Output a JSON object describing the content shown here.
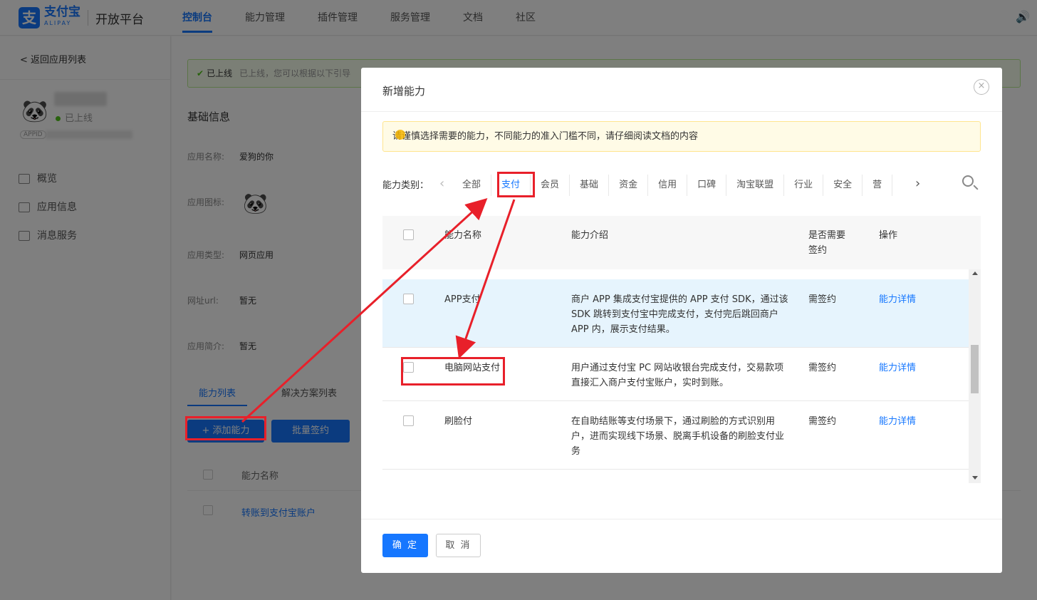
{
  "topbar": {
    "logo_mark": "支",
    "logo_cn": "支付宝",
    "logo_en": "ALIPAY",
    "platform": "开放平台",
    "nav": [
      {
        "label": "控制台",
        "active": true
      },
      {
        "label": "能力管理"
      },
      {
        "label": "插件管理"
      },
      {
        "label": "服务管理"
      },
      {
        "label": "文档"
      },
      {
        "label": "社区"
      }
    ],
    "speaker_icon": "speaker-icon"
  },
  "sidebar": {
    "back_label": "< 返回应用列表",
    "app_status": "已上线",
    "appid_badge": "APPID",
    "menu": [
      {
        "label": "概览",
        "icon": "monitor-icon"
      },
      {
        "label": "应用信息",
        "icon": "grid-icon"
      },
      {
        "label": "消息服务",
        "icon": "message-icon"
      }
    ]
  },
  "main": {
    "notice_strong": "已上线",
    "notice_text": "已上线，您可以根据以下引导",
    "section_title": "基础信息",
    "fields": [
      {
        "label": "应用名称:",
        "value": "爱狗的你"
      },
      {
        "label": "应用图标:",
        "value": ""
      },
      {
        "label": "应用类型:",
        "value": "网页应用"
      },
      {
        "label": "网址url:",
        "value": "暂无"
      },
      {
        "label": "应用简介:",
        "value": "暂无"
      }
    ],
    "tabs": [
      "能力列表",
      "解决方案列表"
    ],
    "add_button": "+ 添加能力",
    "batch_button": "批量签约",
    "table_head_name": "能力名称",
    "row_link": "转账到支付宝账户"
  },
  "modal": {
    "title": "新增能力",
    "close_glyph": "×",
    "alert": "请谨慎选择需要的能力，不同能力的准入门槛不同，请仔细阅读文档的内容",
    "category_label": "能力类别：",
    "categories": [
      "全部",
      "支付",
      "会员",
      "基础",
      "资金",
      "信用",
      "口碑",
      "淘宝联盟",
      "行业",
      "安全",
      "营"
    ],
    "active_category": "支付",
    "table": {
      "headers": {
        "name": "能力名称",
        "desc": "能力介绍",
        "sign": "是否需要签约",
        "op": "操作"
      },
      "rows": [
        {
          "name": "APP支付",
          "desc": "商户 APP 集成支付宝提供的 APP 支付 SDK，通过该 SDK 跳转到支付宝中完成支付，支付完后跳回商户 APP 内，展示支付结果。",
          "sign": "需签约",
          "op": "能力详情",
          "highlighted": true
        },
        {
          "name": "电脑网站支付",
          "desc": "用户通过支付宝 PC 网站收银台完成支付，交易款项直接汇入商户支付宝账户，实时到账。",
          "sign": "需签约",
          "op": "能力详情",
          "highlighted": false
        },
        {
          "name": "刷脸付",
          "desc": "在自助结账等支付场景下，通过刷脸的方式识别用户，进而实现线下场景、脱离手机设备的刷脸支付业务",
          "sign": "需签约",
          "op": "能力详情",
          "highlighted": false
        }
      ]
    },
    "ok_button": "确 定",
    "cancel_button": "取 消"
  },
  "colors": {
    "brand": "#1677ff",
    "annotation": "#e8202a",
    "highlight_row": "#e6f4fd",
    "alert_bg": "#fffbe6"
  }
}
